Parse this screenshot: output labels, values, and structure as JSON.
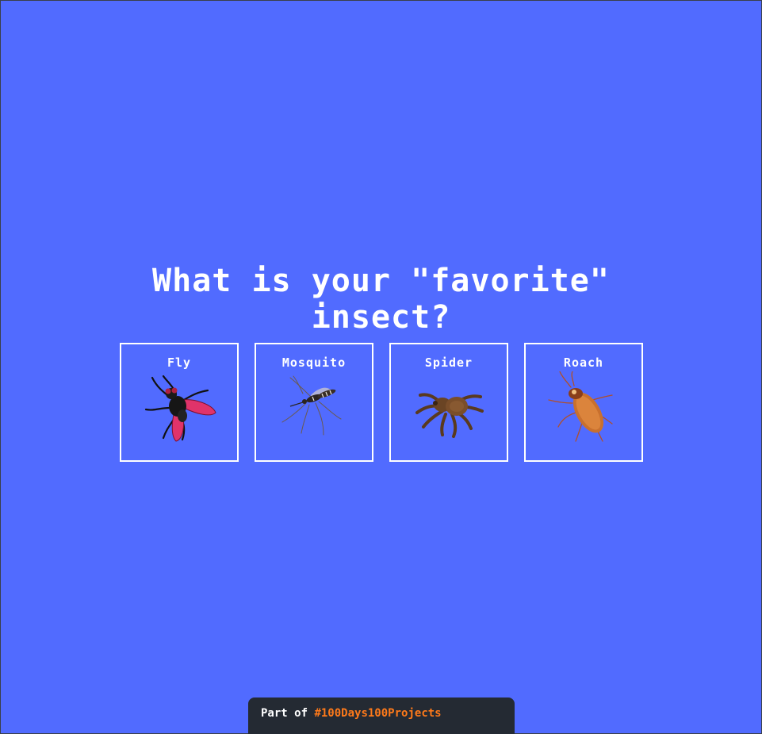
{
  "page": {
    "background": "#516bff",
    "title_line1": "What is your \"favorite\"",
    "title_line2": "insect?"
  },
  "insects": [
    {
      "label": "Fly",
      "icon": "fly-icon"
    },
    {
      "label": "Mosquito",
      "icon": "mosquito-icon"
    },
    {
      "label": "Spider",
      "icon": "spider-icon"
    },
    {
      "label": "Roach",
      "icon": "roach-icon"
    }
  ],
  "footer": {
    "prefix": "Part of",
    "link_text": "#100Days100Projects",
    "link_color": "#ff7a1a",
    "background": "#242a33"
  }
}
